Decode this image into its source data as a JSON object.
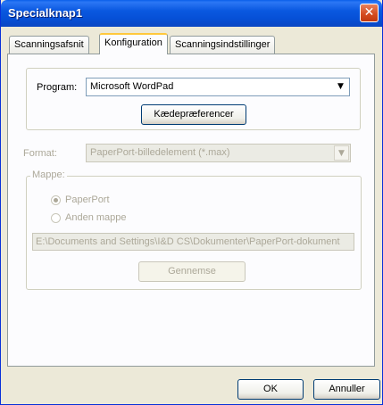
{
  "window": {
    "title": "Specialknap1",
    "close_glyph": "✕"
  },
  "tabs": [
    {
      "label": "Scanningsafsnit",
      "active": false
    },
    {
      "label": "Konfiguration",
      "active": true
    },
    {
      "label": "Scanningsindstillinger",
      "active": false
    }
  ],
  "program": {
    "label": "Program:",
    "value": "Microsoft WordPad",
    "chain_button": "Kædepræferencer"
  },
  "format": {
    "label": "Format:",
    "value": "PaperPort-billedelement (*.max)"
  },
  "folder": {
    "label": "Mappe:",
    "options": [
      {
        "label": "PaperPort",
        "selected": true
      },
      {
        "label": "Anden mappe",
        "selected": false
      }
    ],
    "path": "E:\\Documents and Settings\\I&D CS\\Dokumenter\\PaperPort-dokument",
    "browse_button": "Gennemse"
  },
  "footer": {
    "ok": "OK",
    "cancel": "Annuller"
  },
  "icons": {
    "dropdown": "▼"
  },
  "colors": {
    "titlebar": "#0a58e0",
    "disabled_text": "#aca899",
    "window_bg": "#ece9d8"
  }
}
